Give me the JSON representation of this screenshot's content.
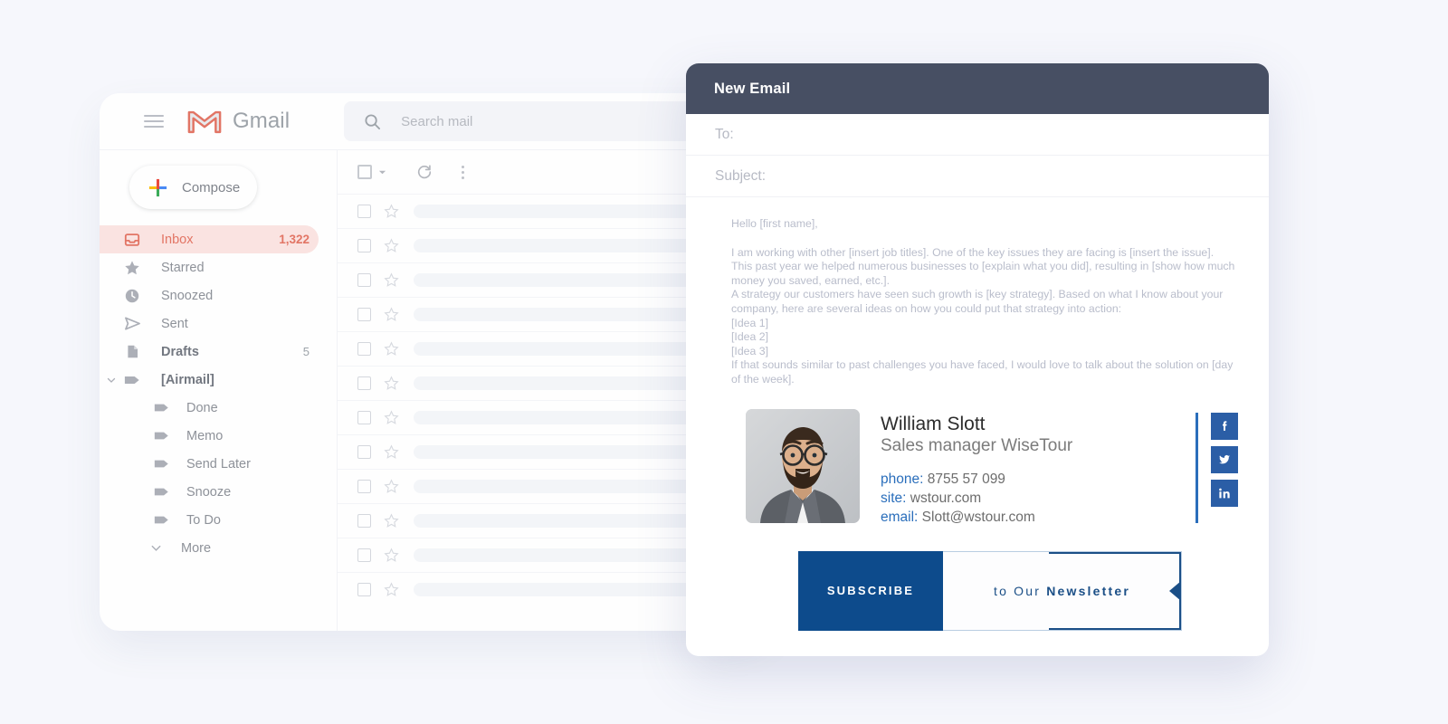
{
  "gmail": {
    "brand": "Gmail",
    "menu_icon": "hamburger-icon",
    "search": {
      "placeholder": "Search mail",
      "icon": "search-icon"
    },
    "compose": {
      "label": "Compose",
      "icon": "plus-icon"
    },
    "nav": [
      {
        "label": "Inbox",
        "count": "1,322",
        "icon": "inbox-icon",
        "state": "active"
      },
      {
        "label": "Starred",
        "count": "",
        "icon": "star-icon",
        "state": "normal"
      },
      {
        "label": "Snoozed",
        "count": "",
        "icon": "clock-icon",
        "state": "normal"
      },
      {
        "label": "Sent",
        "count": "",
        "icon": "send-icon",
        "state": "normal"
      },
      {
        "label": "Drafts",
        "count": "5",
        "icon": "draft-icon",
        "state": "bold"
      },
      {
        "label": "[Airmail]",
        "count": "",
        "icon": "label-icon",
        "state": "bold-caret"
      },
      {
        "label": "Done",
        "count": "",
        "icon": "label-icon",
        "state": "nested"
      },
      {
        "label": "Memo",
        "count": "",
        "icon": "label-icon",
        "state": "nested"
      },
      {
        "label": "Send Later",
        "count": "",
        "icon": "label-icon",
        "state": "nested"
      },
      {
        "label": "Snooze",
        "count": "",
        "icon": "label-icon",
        "state": "nested"
      },
      {
        "label": "To Do",
        "count": "",
        "icon": "label-icon",
        "state": "nested"
      },
      {
        "label": "More",
        "count": "",
        "icon": "chevron-down-icon",
        "state": "more"
      }
    ],
    "toolbar": {
      "select_all": "select-all-checkbox",
      "select_caret": "chevron-down-icon",
      "refresh": "refresh-icon",
      "more": "more-vertical-icon"
    },
    "list_row_count": 12
  },
  "compose": {
    "title": "New Email",
    "to_label": "To:",
    "subject_label": "Subject:",
    "body": {
      "greeting": "Hello [first name],",
      "paragraph1": "I am working with other [insert job titles]. One of the key issues they are facing is [insert the issue].\nThis past year we helped numerous businesses to [explain what you did], resulting in [show how much money you saved, earned, etc.].\nA strategy our customers have seen such growth is [key strategy]. Based on what I know about your company, here are several ideas on how you could put that strategy into action:\n[Idea 1]\n[Idea 2]\n[Idea 3]\nIf that sounds similar to past challenges you have faced, I would love to talk about the solution on [day of the week]."
    },
    "signature": {
      "avatar": "profile-photo",
      "name": "William Slott",
      "role": "Sales manager WiseTour",
      "phone_key": "phone:",
      "phone_value": "8755 57 099",
      "site_key": "site:",
      "site_value": "wstour.com",
      "email_key": "email:",
      "email_value": "Slott@wstour.com",
      "socials": [
        {
          "name": "facebook-icon"
        },
        {
          "name": "twitter-icon"
        },
        {
          "name": "linkedin-icon"
        }
      ]
    },
    "banner": {
      "cta": "SUBSCRIBE",
      "text_light": "to Our ",
      "text_bold": "Newsletter"
    }
  },
  "colors": {
    "page_background": "#f6f7fc",
    "compose_header": "#474f63",
    "inbox_accent": "#e2705f",
    "inbox_accent_bg": "#fbe3e0",
    "brand_blue": "#0d4b8c",
    "social_blue": "#2b5ea6",
    "link_blue": "#2a6ebb"
  }
}
